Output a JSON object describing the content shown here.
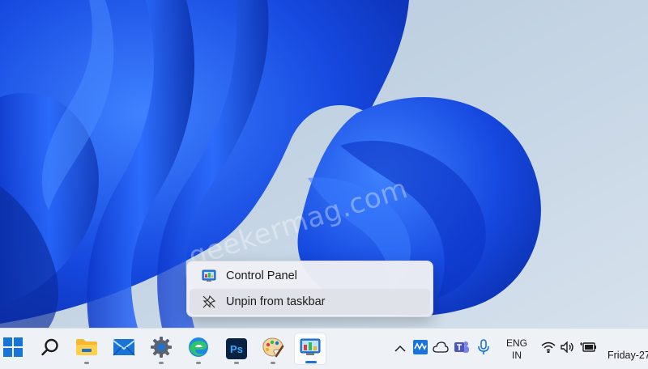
{
  "watermark": {
    "text": "geekermag.com"
  },
  "context_menu": {
    "items": [
      {
        "label": "Control Panel",
        "icon": "control-panel-icon"
      },
      {
        "label": "Unpin from taskbar",
        "icon": "unpin-icon"
      }
    ],
    "hovered_index": 1
  },
  "taskbar": {
    "pinned": [
      {
        "name": "start",
        "icon": "windows-logo-icon"
      },
      {
        "name": "search",
        "icon": "search-icon"
      },
      {
        "name": "file-explorer",
        "icon": "folder-icon",
        "running": true
      },
      {
        "name": "mail",
        "icon": "mail-icon"
      },
      {
        "name": "settings",
        "icon": "gear-icon",
        "running": true
      },
      {
        "name": "edge",
        "icon": "edge-icon",
        "running": true
      },
      {
        "name": "photoshop",
        "icon": "photoshop-icon",
        "label": "Ps",
        "running": true
      },
      {
        "name": "paint",
        "icon": "paint-palette-icon",
        "running": true
      },
      {
        "name": "control-panel",
        "icon": "control-panel-icon",
        "running": true,
        "active": true
      }
    ],
    "tray": {
      "icons": [
        "chevron-up-icon",
        "waves-icon",
        "onedrive-cloud-icon",
        "teams-icon",
        "microphone-icon"
      ],
      "language": {
        "line1": "ENG",
        "line2": "IN"
      },
      "status_icons": [
        "wifi-icon",
        "volume-icon",
        "battery-icon"
      ],
      "clock": "Friday-27"
    }
  },
  "colors": {
    "wallpaper_bg": "#c8d7e6",
    "wallpaper_blue": "#1a4fe0",
    "taskbar_bg": "#eef2f7",
    "accent": "#1a73d6"
  }
}
